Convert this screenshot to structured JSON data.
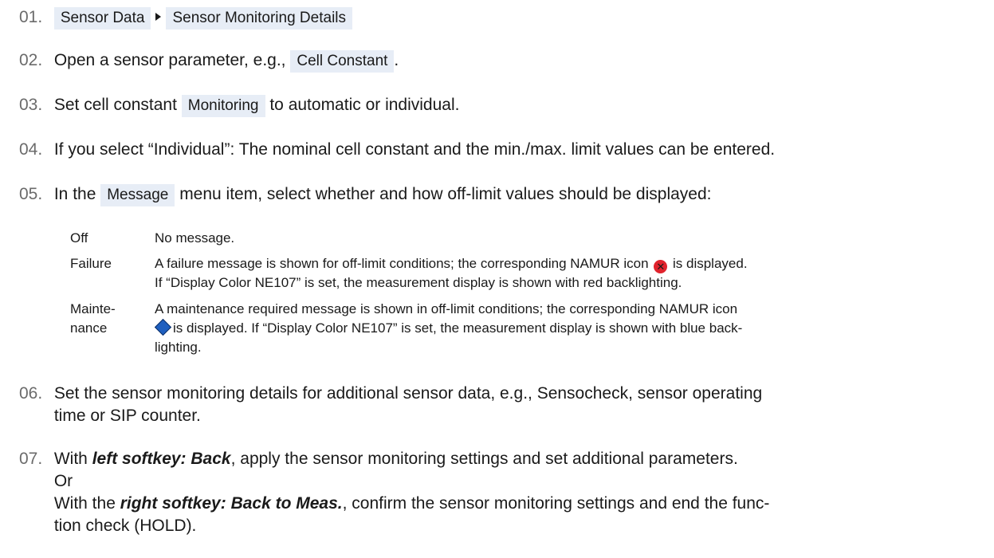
{
  "steps": [
    {
      "num": "01.",
      "chip1": "Sensor Data",
      "chip2": "Sensor Monitoring Details"
    },
    {
      "num": "02.",
      "pre": "Open a sensor parameter, e.g.,",
      "chip": "Cell Constant",
      "post": "."
    },
    {
      "num": "03.",
      "pre": "Set cell constant",
      "chip": "Monitoring",
      "post": "to automatic or individual."
    },
    {
      "num": "04.",
      "text": "If you select “Individual”: The nominal cell constant and the min./max. limit values can be entered."
    },
    {
      "num": "05.",
      "pre": "In the",
      "chip": "Message",
      "post": "menu item, select whether and how off-limit values should be displayed:"
    },
    {
      "num": "06.",
      "line1": "Set the sensor monitoring details for additional sensor data, e.g., Sensocheck, sensor operating",
      "line2": "time or SIP counter."
    },
    {
      "num": "07.",
      "l1_pre": "With",
      "l1_bold": "left softkey: Back",
      "l1_post": ", apply the sensor monitoring settings and set additional parameters.",
      "l2": "Or",
      "l3_pre": "With the",
      "l3_bold": "right softkey: Back to Meas.",
      "l3_post": ", confirm the sensor monitoring settings and end the func-",
      "l4": "tion check (HOLD)."
    }
  ],
  "options": [
    {
      "term": "Off",
      "desc": "No message."
    },
    {
      "term": "Failure",
      "desc_a": "A failure message is shown for off-limit conditions; the corresponding NAMUR icon",
      "desc_b": "is displayed.",
      "desc_c": "If “Display Color NE107” is set, the measurement display is shown with red backlighting.",
      "icon": "namur-failure-icon",
      "icon_color": "#e0232d"
    },
    {
      "term": "Mainte-nance",
      "term_l1": "Mainte-",
      "term_l2": "nance",
      "desc_a": "A maintenance required message is shown in off-limit conditions; the corresponding NAMUR icon",
      "desc_b": "is displayed. If “Display Color NE107” is set, the measurement display is shown with blue back-",
      "desc_c": "lighting.",
      "icon": "namur-maintenance-icon",
      "icon_color": "#1f5fbf"
    }
  ],
  "fail_icon_glyph": "✕"
}
